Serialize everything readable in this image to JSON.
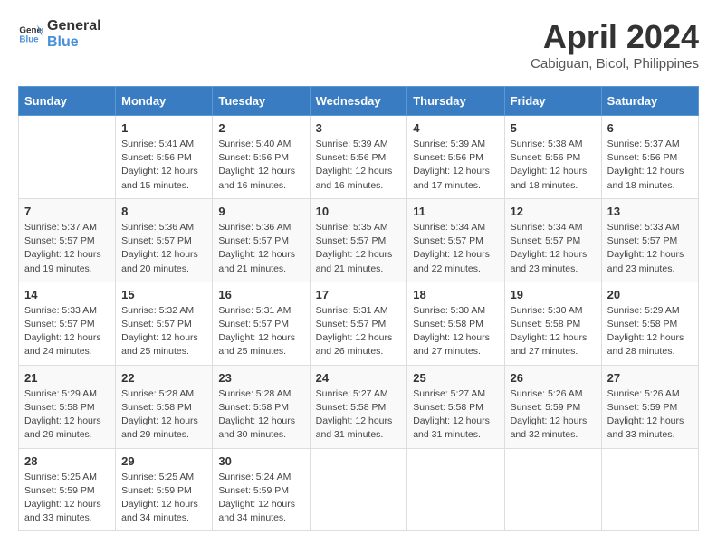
{
  "header": {
    "logo_line1": "General",
    "logo_line2": "Blue",
    "month": "April 2024",
    "location": "Cabiguan, Bicol, Philippines"
  },
  "weekdays": [
    "Sunday",
    "Monday",
    "Tuesday",
    "Wednesday",
    "Thursday",
    "Friday",
    "Saturday"
  ],
  "weeks": [
    [
      {
        "day": "",
        "content": ""
      },
      {
        "day": "1",
        "content": "Sunrise: 5:41 AM\nSunset: 5:56 PM\nDaylight: 12 hours\nand 15 minutes."
      },
      {
        "day": "2",
        "content": "Sunrise: 5:40 AM\nSunset: 5:56 PM\nDaylight: 12 hours\nand 16 minutes."
      },
      {
        "day": "3",
        "content": "Sunrise: 5:39 AM\nSunset: 5:56 PM\nDaylight: 12 hours\nand 16 minutes."
      },
      {
        "day": "4",
        "content": "Sunrise: 5:39 AM\nSunset: 5:56 PM\nDaylight: 12 hours\nand 17 minutes."
      },
      {
        "day": "5",
        "content": "Sunrise: 5:38 AM\nSunset: 5:56 PM\nDaylight: 12 hours\nand 18 minutes."
      },
      {
        "day": "6",
        "content": "Sunrise: 5:37 AM\nSunset: 5:56 PM\nDaylight: 12 hours\nand 18 minutes."
      }
    ],
    [
      {
        "day": "7",
        "content": "Sunrise: 5:37 AM\nSunset: 5:57 PM\nDaylight: 12 hours\nand 19 minutes."
      },
      {
        "day": "8",
        "content": "Sunrise: 5:36 AM\nSunset: 5:57 PM\nDaylight: 12 hours\nand 20 minutes."
      },
      {
        "day": "9",
        "content": "Sunrise: 5:36 AM\nSunset: 5:57 PM\nDaylight: 12 hours\nand 21 minutes."
      },
      {
        "day": "10",
        "content": "Sunrise: 5:35 AM\nSunset: 5:57 PM\nDaylight: 12 hours\nand 21 minutes."
      },
      {
        "day": "11",
        "content": "Sunrise: 5:34 AM\nSunset: 5:57 PM\nDaylight: 12 hours\nand 22 minutes."
      },
      {
        "day": "12",
        "content": "Sunrise: 5:34 AM\nSunset: 5:57 PM\nDaylight: 12 hours\nand 23 minutes."
      },
      {
        "day": "13",
        "content": "Sunrise: 5:33 AM\nSunset: 5:57 PM\nDaylight: 12 hours\nand 23 minutes."
      }
    ],
    [
      {
        "day": "14",
        "content": "Sunrise: 5:33 AM\nSunset: 5:57 PM\nDaylight: 12 hours\nand 24 minutes."
      },
      {
        "day": "15",
        "content": "Sunrise: 5:32 AM\nSunset: 5:57 PM\nDaylight: 12 hours\nand 25 minutes."
      },
      {
        "day": "16",
        "content": "Sunrise: 5:31 AM\nSunset: 5:57 PM\nDaylight: 12 hours\nand 25 minutes."
      },
      {
        "day": "17",
        "content": "Sunrise: 5:31 AM\nSunset: 5:57 PM\nDaylight: 12 hours\nand 26 minutes."
      },
      {
        "day": "18",
        "content": "Sunrise: 5:30 AM\nSunset: 5:58 PM\nDaylight: 12 hours\nand 27 minutes."
      },
      {
        "day": "19",
        "content": "Sunrise: 5:30 AM\nSunset: 5:58 PM\nDaylight: 12 hours\nand 27 minutes."
      },
      {
        "day": "20",
        "content": "Sunrise: 5:29 AM\nSunset: 5:58 PM\nDaylight: 12 hours\nand 28 minutes."
      }
    ],
    [
      {
        "day": "21",
        "content": "Sunrise: 5:29 AM\nSunset: 5:58 PM\nDaylight: 12 hours\nand 29 minutes."
      },
      {
        "day": "22",
        "content": "Sunrise: 5:28 AM\nSunset: 5:58 PM\nDaylight: 12 hours\nand 29 minutes."
      },
      {
        "day": "23",
        "content": "Sunrise: 5:28 AM\nSunset: 5:58 PM\nDaylight: 12 hours\nand 30 minutes."
      },
      {
        "day": "24",
        "content": "Sunrise: 5:27 AM\nSunset: 5:58 PM\nDaylight: 12 hours\nand 31 minutes."
      },
      {
        "day": "25",
        "content": "Sunrise: 5:27 AM\nSunset: 5:58 PM\nDaylight: 12 hours\nand 31 minutes."
      },
      {
        "day": "26",
        "content": "Sunrise: 5:26 AM\nSunset: 5:59 PM\nDaylight: 12 hours\nand 32 minutes."
      },
      {
        "day": "27",
        "content": "Sunrise: 5:26 AM\nSunset: 5:59 PM\nDaylight: 12 hours\nand 33 minutes."
      }
    ],
    [
      {
        "day": "28",
        "content": "Sunrise: 5:25 AM\nSunset: 5:59 PM\nDaylight: 12 hours\nand 33 minutes."
      },
      {
        "day": "29",
        "content": "Sunrise: 5:25 AM\nSunset: 5:59 PM\nDaylight: 12 hours\nand 34 minutes."
      },
      {
        "day": "30",
        "content": "Sunrise: 5:24 AM\nSunset: 5:59 PM\nDaylight: 12 hours\nand 34 minutes."
      },
      {
        "day": "",
        "content": ""
      },
      {
        "day": "",
        "content": ""
      },
      {
        "day": "",
        "content": ""
      },
      {
        "day": "",
        "content": ""
      }
    ]
  ]
}
